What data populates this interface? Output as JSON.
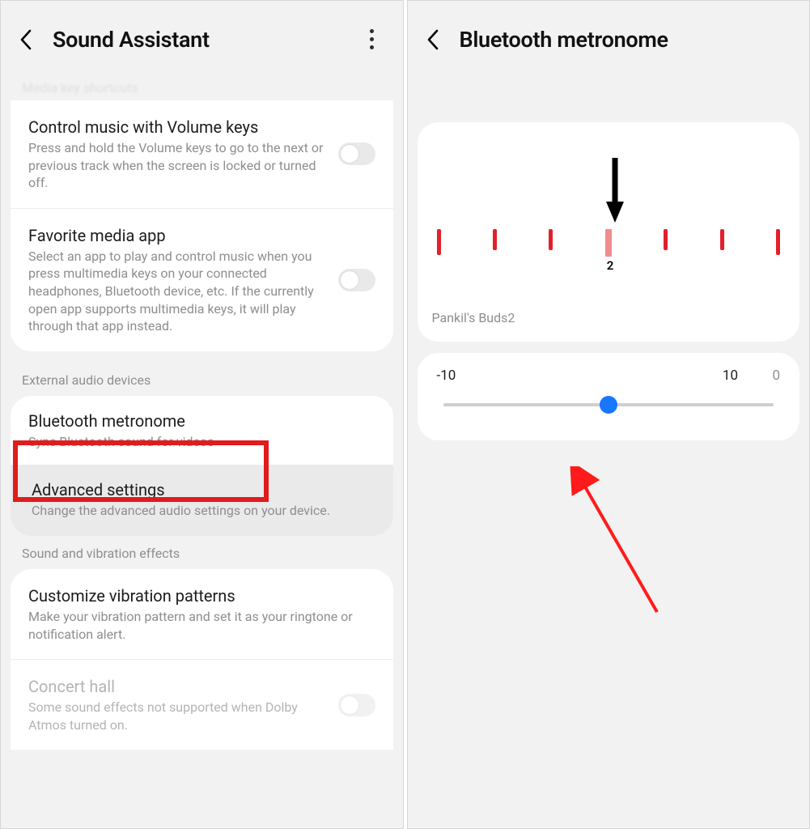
{
  "left": {
    "header": {
      "title": "Sound Assistant"
    },
    "cutoffLabel": "Media key shortcuts",
    "group1": {
      "items": [
        {
          "title": "Control music with Volume keys",
          "sub": "Press and hold the Volume keys to go to the next or previous track when the screen is locked or turned off."
        },
        {
          "title": "Favorite media app",
          "sub": "Select an app to play and control music when you press multimedia keys on your connected headphones, Bluetooth device, etc. If the currently open app supports multimedia keys, it will play through that app instead."
        }
      ]
    },
    "sectionExternal": "External audio devices",
    "btMetronome": {
      "title": "Bluetooth metronome",
      "sub": "Sync Bluetooth sound for videos"
    },
    "advanced": {
      "title": "Advanced settings",
      "sub": "Change the advanced audio settings on your device."
    },
    "sectionSoundVib": "Sound and vibration effects",
    "group3": {
      "items": [
        {
          "title": "Customize vibration patterns",
          "sub": "Make your vibration pattern and set it as your ringtone or notification alert."
        },
        {
          "title": "Concert hall",
          "sub": "Some sound effects not supported when Dolby Atmos turned on."
        }
      ]
    }
  },
  "right": {
    "header": {
      "title": "Bluetooth metronome"
    },
    "indicatorLabel": "2",
    "deviceName": "Pankil's Buds2",
    "slider": {
      "min": "-10",
      "max": "10",
      "value": "0"
    }
  }
}
